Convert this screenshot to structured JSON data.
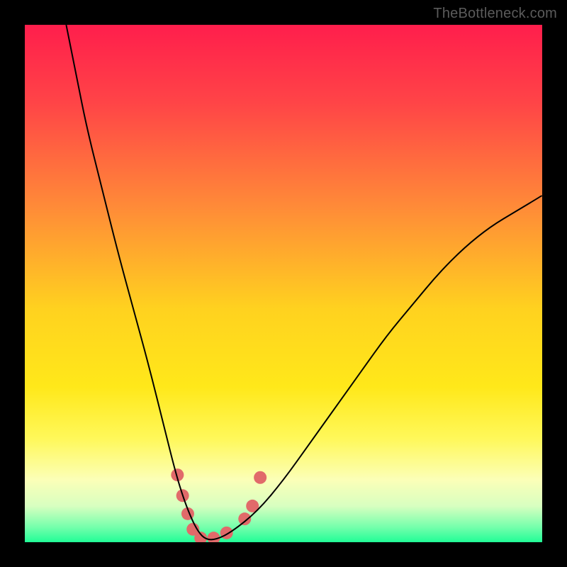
{
  "watermark": {
    "text": "TheBottleneck.com"
  },
  "axes": {
    "x_range": [
      0,
      100
    ],
    "y_range": [
      0,
      100
    ],
    "grid": false,
    "ticks_visible": false,
    "legend": false
  },
  "gradient": {
    "stops": [
      {
        "offset": 0,
        "color": "#ff1e4c"
      },
      {
        "offset": 0.15,
        "color": "#ff4447"
      },
      {
        "offset": 0.35,
        "color": "#ff8a38"
      },
      {
        "offset": 0.55,
        "color": "#ffd21f"
      },
      {
        "offset": 0.7,
        "color": "#ffe81a"
      },
      {
        "offset": 0.8,
        "color": "#fff85a"
      },
      {
        "offset": 0.88,
        "color": "#fbffb8"
      },
      {
        "offset": 0.93,
        "color": "#d8ffc0"
      },
      {
        "offset": 0.97,
        "color": "#77ffac"
      },
      {
        "offset": 1.0,
        "color": "#21fd97"
      }
    ]
  },
  "chart_data": {
    "type": "line",
    "title": "",
    "xlabel": "",
    "ylabel": "",
    "xlim": [
      0,
      100
    ],
    "ylim": [
      0,
      100
    ],
    "series": [
      {
        "name": "bottleneck-curve",
        "color": "#000000",
        "width": 2,
        "x": [
          8,
          10,
          12,
          15,
          18,
          21,
          24,
          27,
          29,
          30.5,
          32,
          33.5,
          35,
          37,
          40,
          45,
          50,
          55,
          60,
          65,
          70,
          75,
          80,
          85,
          90,
          95,
          100
        ],
        "y": [
          100,
          90,
          80,
          68,
          56,
          45,
          34,
          22,
          14,
          9,
          5,
          2,
          0.5,
          0.5,
          2,
          6,
          12,
          19,
          26,
          33,
          40,
          46,
          52,
          57,
          61,
          64,
          67
        ]
      },
      {
        "name": "highlight-dots",
        "type": "scatter",
        "color": "#e16a6a",
        "radius": 9,
        "points": [
          {
            "x": 29.5,
            "y": 13.0
          },
          {
            "x": 30.5,
            "y": 9.0
          },
          {
            "x": 31.5,
            "y": 5.5
          },
          {
            "x": 32.5,
            "y": 2.5
          },
          {
            "x": 34.0,
            "y": 0.8
          },
          {
            "x": 36.5,
            "y": 0.8
          },
          {
            "x": 39.0,
            "y": 1.8
          },
          {
            "x": 42.5,
            "y": 4.5
          },
          {
            "x": 44.0,
            "y": 7.0
          },
          {
            "x": 45.5,
            "y": 12.5
          }
        ]
      }
    ]
  }
}
